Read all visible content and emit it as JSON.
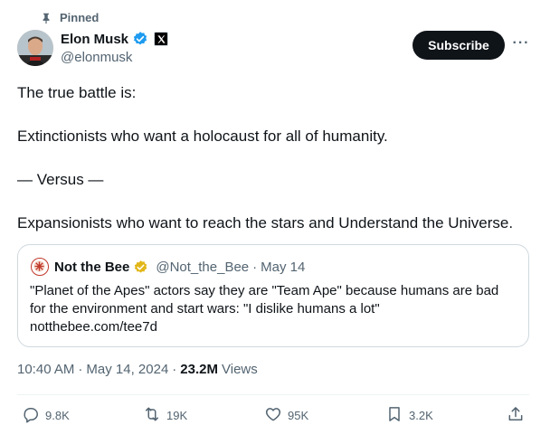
{
  "header": {
    "pinned_label": "Pinned",
    "pin_icon": "pin-icon"
  },
  "author": {
    "display_name": "Elon Musk",
    "handle": "@elonmusk",
    "verified_icon": "verified-badge-icon",
    "affiliation_icon": "x-logo-icon",
    "verified_color": "#1d9bf0"
  },
  "actions_top": {
    "subscribe_label": "Subscribe",
    "more_label": "···"
  },
  "tweet": {
    "lines": [
      "The true battle is:",
      "Extinctionists who want a holocaust for all of humanity.",
      "— Versus —",
      "Expansionists who want to reach the stars and Understand the Universe."
    ]
  },
  "quote": {
    "display_name": "Not the Bee",
    "handle": "@Not_the_Bee",
    "separator": "·",
    "date": "May 14",
    "badge_color": "#e2b719",
    "text_line1": "\"Planet of the Apes\" actors say they are \"Team Ape\" because humans are bad",
    "text_line2": "for the environment and start wars: \"I dislike humans a lot\"",
    "link": "notthebee.com/tee7d"
  },
  "meta": {
    "time": "10:40 AM",
    "sep1": "·",
    "date": "May 14, 2024",
    "sep2": "·",
    "views_count": "23.2M",
    "views_label": "Views"
  },
  "engagement": {
    "replies": "9.8K",
    "reposts": "19K",
    "likes": "95K",
    "bookmarks": "3.2K"
  },
  "colors": {
    "text_primary": "#0f1419",
    "text_secondary": "#536471",
    "border": "#cfd9de"
  }
}
